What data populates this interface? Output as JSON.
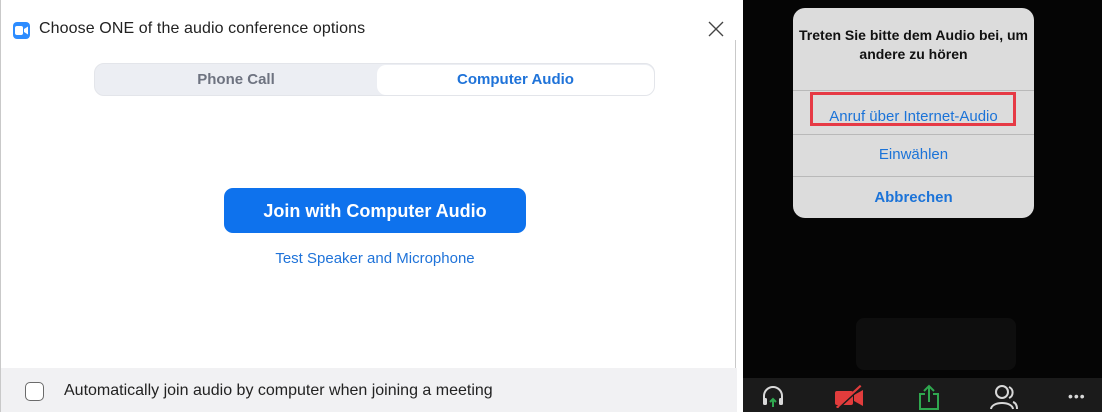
{
  "dialog": {
    "title": "Choose ONE of the audio conference options",
    "tabs": [
      {
        "label": "Phone Call"
      },
      {
        "label": "Computer Audio"
      }
    ],
    "join_button_label": "Join with Computer Audio",
    "test_link_label": "Test Speaker and Microphone",
    "auto_join_label": "Automatically join audio by computer when joining a meeting"
  },
  "mobile": {
    "alert_title": "Treten Sie bitte dem Audio bei, um andere zu hören",
    "actions": [
      {
        "label": "Anruf über Internet-Audio"
      },
      {
        "label": "Einwählen"
      },
      {
        "label": "Abbrechen"
      }
    ],
    "toolbar_icons": [
      "headphones-icon",
      "video-off-icon",
      "share-icon",
      "participants-icon",
      "more-icon"
    ],
    "toolbar_more": "•••"
  },
  "colors": {
    "accent_blue": "#0e72ed",
    "link_blue": "#1f73d9",
    "highlight_red": "#e63a45",
    "video_off_red": "#e13c3c",
    "share_green": "#2fa84f"
  }
}
